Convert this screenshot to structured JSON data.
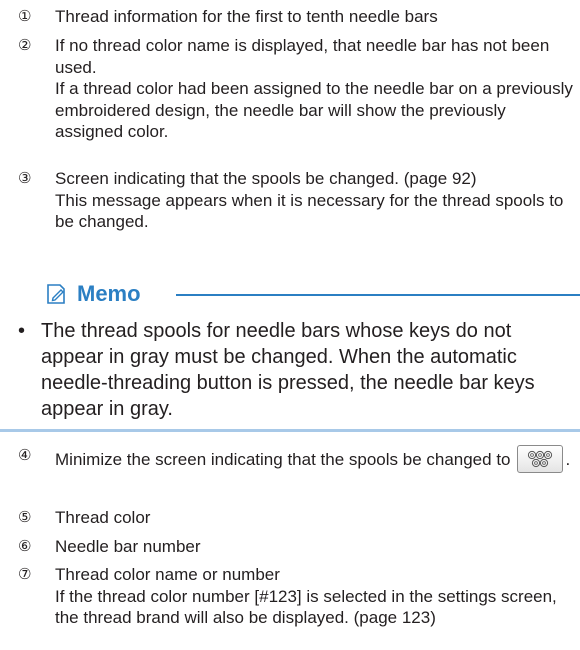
{
  "items": [
    {
      "num": "①",
      "lines": [
        "Thread information for the first to tenth needle bars"
      ]
    },
    {
      "num": "②",
      "lines": [
        "If no thread color name is displayed, that needle bar has not been used.",
        "If a thread color had been assigned to the needle bar on a previously embroidered design, the needle bar will show the previously assigned color."
      ]
    },
    {
      "num": "③",
      "lines": [
        "Screen indicating that the spools be changed. (page 92)",
        "This message appears when it is necessary for the thread spools to be changed."
      ]
    },
    {
      "num": "④",
      "text_before": "Minimize the screen indicating that the spools be changed to",
      "text_after": "."
    },
    {
      "num": "⑤",
      "lines": [
        "Thread color"
      ]
    },
    {
      "num": "⑥",
      "lines": [
        "Needle bar number"
      ]
    },
    {
      "num": "⑦",
      "lines": [
        "Thread color name or number",
        "If the thread color number [#123] is selected in the settings screen, the thread brand will also be displayed. (page 123)"
      ]
    }
  ],
  "memo": {
    "title": "Memo",
    "bullet": "•",
    "text": "The thread spools for needle bars whose keys do not appear in gray must be changed. When the automatic needle-threading button is pressed, the needle bar keys appear in gray."
  },
  "icons": {
    "memo": "memo-pencil-icon",
    "spool_button": "minimize-spool-icon"
  },
  "colors": {
    "accent": "#2b7fc3",
    "rule_light": "#a8c9e8",
    "text": "#231f20"
  }
}
